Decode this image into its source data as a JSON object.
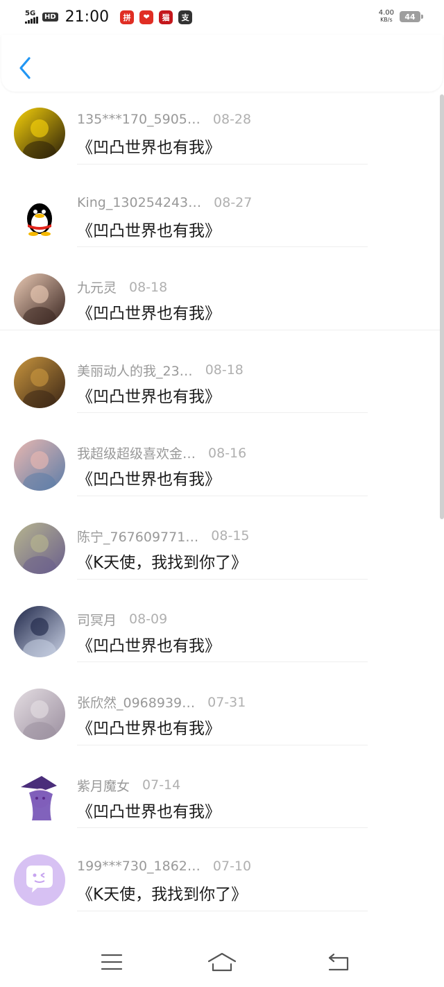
{
  "status_bar": {
    "network": "5G",
    "hd": "HD",
    "time": "21:00",
    "app_icons": [
      {
        "name": "pinduoduo-icon",
        "glyph": "拼",
        "color": "#e02e24"
      },
      {
        "name": "taobao-icon",
        "glyph": "❤",
        "color": "#e02e24"
      },
      {
        "name": "tmall-icon",
        "glyph": "猫",
        "color": "#c4171c"
      },
      {
        "name": "alipay-icon",
        "glyph": "支",
        "color": "#333333"
      }
    ],
    "speed_value": "4.00",
    "speed_unit": "KB/s",
    "battery": "44"
  },
  "header": {
    "back_icon": "chevron-left-icon",
    "accent_color": "#2196f3"
  },
  "messages": [
    {
      "username": "135***170_5905…",
      "date": "08-28",
      "content": "《凹凸世界也有我》",
      "avatar_colors": [
        "#f6d10a",
        "#2a1f0a"
      ]
    },
    {
      "username": "King_130254243…",
      "date": "08-27",
      "content": "《凹凸世界也有我》",
      "avatar_colors": [
        "#ffffff",
        "#000000"
      ]
    },
    {
      "username": "九元灵",
      "date": "08-18",
      "content": "《凹凸世界也有我》",
      "avatar_colors": [
        "#e9c9b4",
        "#3a2621"
      ]
    },
    {
      "username": "美丽动人的我_23…",
      "date": "08-18",
      "content": "《凹凸世界也有我》",
      "avatar_colors": [
        "#c8953e",
        "#3b2616"
      ]
    },
    {
      "username": "我超级超级喜欢金…",
      "date": "08-16",
      "content": "《凹凸世界也有我》",
      "avatar_colors": [
        "#e8b7b0",
        "#5d7da8"
      ]
    },
    {
      "username": "陈宁_767609771…",
      "date": "08-15",
      "content": "《K天使，我找到你了》",
      "avatar_colors": [
        "#b7b58f",
        "#6a5f8c"
      ]
    },
    {
      "username": "司冥月",
      "date": "08-09",
      "content": "《凹凸世界也有我》",
      "avatar_colors": [
        "#20284a",
        "#c9d1e4"
      ]
    },
    {
      "username": "张欣然_0968939…",
      "date": "07-31",
      "content": "《凹凸世界也有我》",
      "avatar_colors": [
        "#e4dde2",
        "#9b8f9f"
      ]
    },
    {
      "username": "紫月魔女",
      "date": "07-14",
      "content": "《凹凸世界也有我》",
      "avatar_colors": [
        "#ffffff",
        "#4a2d7a"
      ]
    },
    {
      "username": "199***730_1862…",
      "date": "07-10",
      "content": "《K天使，我找到你了》",
      "avatar_colors": [
        "#d7c1f3",
        "#ffffff"
      ]
    }
  ],
  "nav": {
    "menu_icon": "menu-icon",
    "home_icon": "home-icon",
    "back_icon": "back-icon"
  }
}
